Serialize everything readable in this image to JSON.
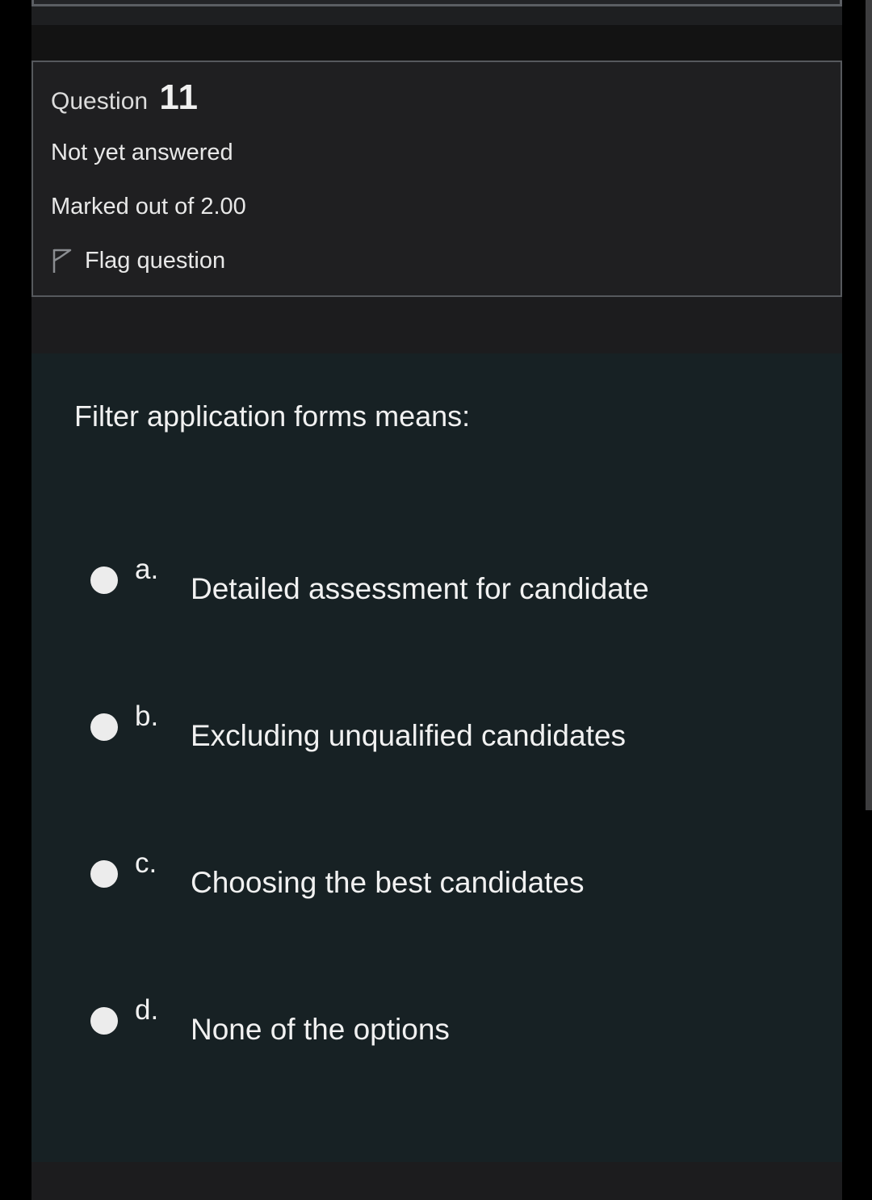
{
  "question": {
    "label": "Question",
    "number": "11",
    "status": "Not yet answered",
    "marks": "Marked out of 2.00",
    "flag_label": "Flag question"
  },
  "content": {
    "prompt": "Filter application forms means:",
    "answers": [
      {
        "letter": "a.",
        "text": "Detailed assessment for candidate"
      },
      {
        "letter": "b.",
        "text": "Excluding unqualified candidates"
      },
      {
        "letter": "c.",
        "text": "Choosing the best candidates"
      },
      {
        "letter": "d.",
        "text": "None of the options"
      }
    ]
  },
  "icons": {
    "flag": "flag-outline-icon",
    "radio": "radio-unselected"
  },
  "colors": {
    "background": "#000000",
    "info_box": "#1f1f21",
    "content_box": "#172124",
    "text": "#f1f1f1",
    "radio": "#ececec"
  }
}
